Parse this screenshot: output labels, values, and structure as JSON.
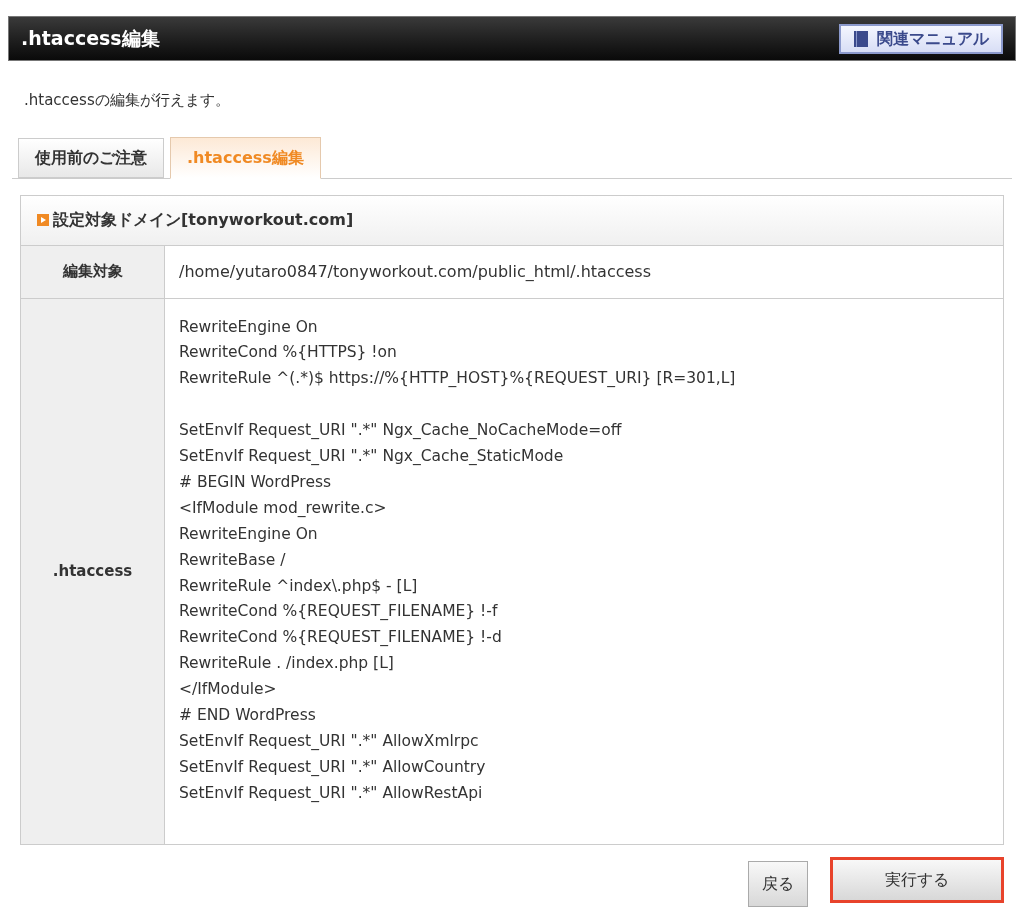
{
  "header": {
    "title": ".htaccess編集",
    "manual_button": "関連マニュアル"
  },
  "description": ".htaccessの編集が行えます。",
  "tabs": [
    {
      "label": "使用前のご注意",
      "selected": false
    },
    {
      "label": ".htaccess編集",
      "selected": true
    }
  ],
  "section": {
    "title": "設定対象ドメイン[tonyworkout.com]"
  },
  "rows": [
    {
      "label": "編集対象",
      "kind": "text",
      "value": "/home/yutaro0847/tonyworkout.com/public_html/.htaccess"
    },
    {
      "label": ".htaccess",
      "kind": "editor",
      "value": "RewriteEngine On\nRewriteCond %{HTTPS} !on\nRewriteRule ^(.*)$ https://%{HTTP_HOST}%{REQUEST_URI} [R=301,L]\n\nSetEnvIf Request_URI \".*\" Ngx_Cache_NoCacheMode=off\nSetEnvIf Request_URI \".*\" Ngx_Cache_StaticMode\n# BEGIN WordPress\n<IfModule mod_rewrite.c>\nRewriteEngine On\nRewriteBase /\nRewriteRule ^index\\.php$ - [L]\nRewriteCond %{REQUEST_FILENAME} !-f\nRewriteCond %{REQUEST_FILENAME} !-d\nRewriteRule . /index.php [L]\n</IfModule>\n# END WordPress\nSetEnvIf Request_URI \".*\" AllowXmlrpc\nSetEnvIf Request_URI \".*\" AllowCountry\nSetEnvIf Request_URI \".*\" AllowRestApi"
    }
  ],
  "buttons": [
    {
      "label": "戻る",
      "kind": "back",
      "highlighted": false
    },
    {
      "label": "実行する",
      "kind": "submit",
      "highlighted": true
    }
  ]
}
